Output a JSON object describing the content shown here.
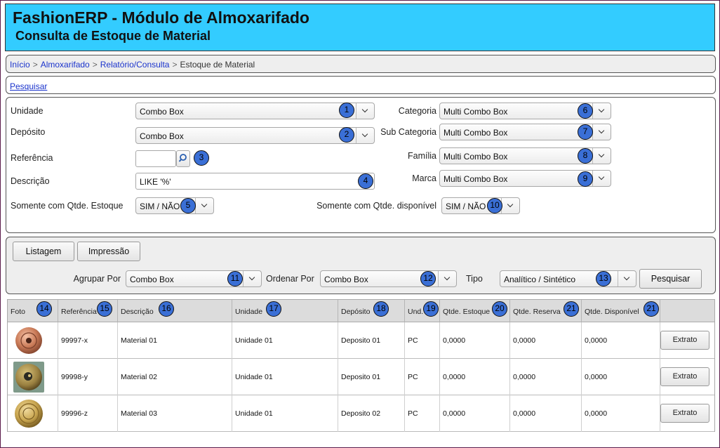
{
  "header": {
    "title": "FashionERP - Módulo de Almoxarifado",
    "subtitle": "Consulta de Estoque de Material"
  },
  "breadcrumb": {
    "items": [
      "Início",
      "Almoxarifado",
      "Relatório/Consulta"
    ],
    "current": "Estoque de Material",
    "separator": ">"
  },
  "search_link": "Pesquisar",
  "filters": {
    "unidade": {
      "label": "Unidade",
      "value": "Combo Box",
      "badge": "1"
    },
    "deposito": {
      "label": "Depósito",
      "value": "Combo Box",
      "badge": "2"
    },
    "referencia": {
      "label": "Referência",
      "value": "",
      "badge": "3"
    },
    "descricao": {
      "label": "Descrição",
      "value": "LIKE '%'",
      "badge": "4"
    },
    "somente_estoque": {
      "label": "Somente com Qtde. Estoque",
      "value": "SIM / NÃO",
      "badge": "5"
    },
    "categoria": {
      "label": "Categoria",
      "value": "Multi Combo Box",
      "badge": "6"
    },
    "sub_categoria": {
      "label": "Sub Categoria",
      "value": "Multi Combo Box",
      "badge": "7"
    },
    "familia": {
      "label": "Família",
      "value": "Multi Combo Box",
      "badge": "8"
    },
    "marca": {
      "label": "Marca",
      "value": "Multi Combo Box",
      "badge": "9"
    },
    "somente_disponivel": {
      "label": "Somente com Qtde. disponível",
      "value": "SIM / NÃO",
      "badge": "10"
    }
  },
  "actions": {
    "listagem": "Listagem",
    "impressao": "Impressão",
    "agrupar": {
      "label": "Agrupar Por",
      "value": "Combo Box",
      "badge": "11"
    },
    "ordenar": {
      "label": "Ordenar Por",
      "value": "Combo Box",
      "badge": "12"
    },
    "tipo": {
      "label": "Tipo",
      "value": "Analítico / Sintético",
      "badge": "13"
    },
    "pesquisar": "Pesquisar"
  },
  "table": {
    "columns": [
      {
        "label": "Foto",
        "badge": "14"
      },
      {
        "label": "Referência",
        "badge": "15"
      },
      {
        "label": "Descrição",
        "badge": "16"
      },
      {
        "label": "Unidade",
        "badge": "17"
      },
      {
        "label": "Depósito",
        "badge": "18"
      },
      {
        "label": "Und.",
        "badge": "19"
      },
      {
        "label": "Qtde. Estoque",
        "badge": "20"
      },
      {
        "label": "Qtde. Reserva",
        "badge": "21"
      },
      {
        "label": "Qtde. Disponível",
        "badge": "21"
      }
    ],
    "rows": [
      {
        "referencia": "99997-x",
        "descricao": "Material 01",
        "unidade": "Unidade 01",
        "deposito": "Deposito 01",
        "und": "PC",
        "estoque": "0,0000",
        "reserva": "0,0000",
        "disponivel": "0,0000",
        "action": "Extrato"
      },
      {
        "referencia": "99998-y",
        "descricao": "Material 02",
        "unidade": "Unidade 01",
        "deposito": "Deposito 01",
        "und": "PC",
        "estoque": "0,0000",
        "reserva": "0,0000",
        "disponivel": "0,0000",
        "action": "Extrato"
      },
      {
        "referencia": "99996-z",
        "descricao": "Material 03",
        "unidade": "Unidade 01",
        "deposito": "Deposito 02",
        "und": "PC",
        "estoque": "0,0000",
        "reserva": "0,0000",
        "disponivel": "0,0000",
        "action": "Extrato"
      }
    ]
  },
  "colors": {
    "header_bg": "#33ccff",
    "badge": "#3a6fd6",
    "link": "#1a33cc"
  }
}
